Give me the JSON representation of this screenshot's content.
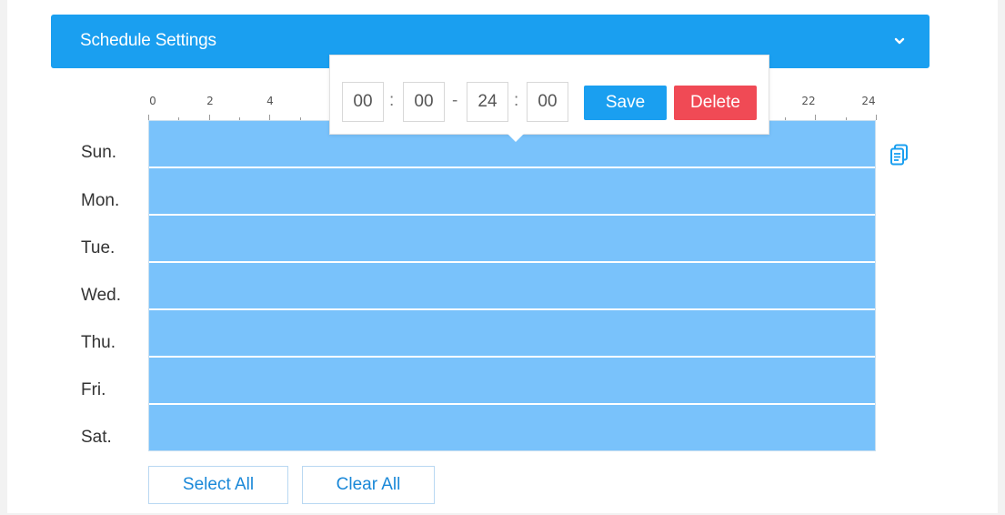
{
  "header": {
    "title": "Schedule Settings",
    "toggle_icon": "chevron-down-icon"
  },
  "ruler": {
    "visible_labels_left": [
      "0",
      "2",
      "4"
    ],
    "visible_labels_right": [
      "22",
      "24"
    ]
  },
  "days": [
    "Sun.",
    "Mon.",
    "Tue.",
    "Wed.",
    "Thu.",
    "Fri.",
    "Sat."
  ],
  "time_editor": {
    "start_hour": "00",
    "start_minute": "00",
    "range_separator": "-",
    "end_hour": "24",
    "end_minute": "00",
    "colon": ":",
    "save_label": "Save",
    "delete_label": "Delete"
  },
  "actions": {
    "select_all_label": "Select All",
    "clear_all_label": "Clear All"
  },
  "icons": {
    "copy": "copy-schedule-icon"
  },
  "colors": {
    "accent": "#1a9ff0",
    "schedule_fill": "#79c2fb",
    "danger": "#f04a55"
  }
}
